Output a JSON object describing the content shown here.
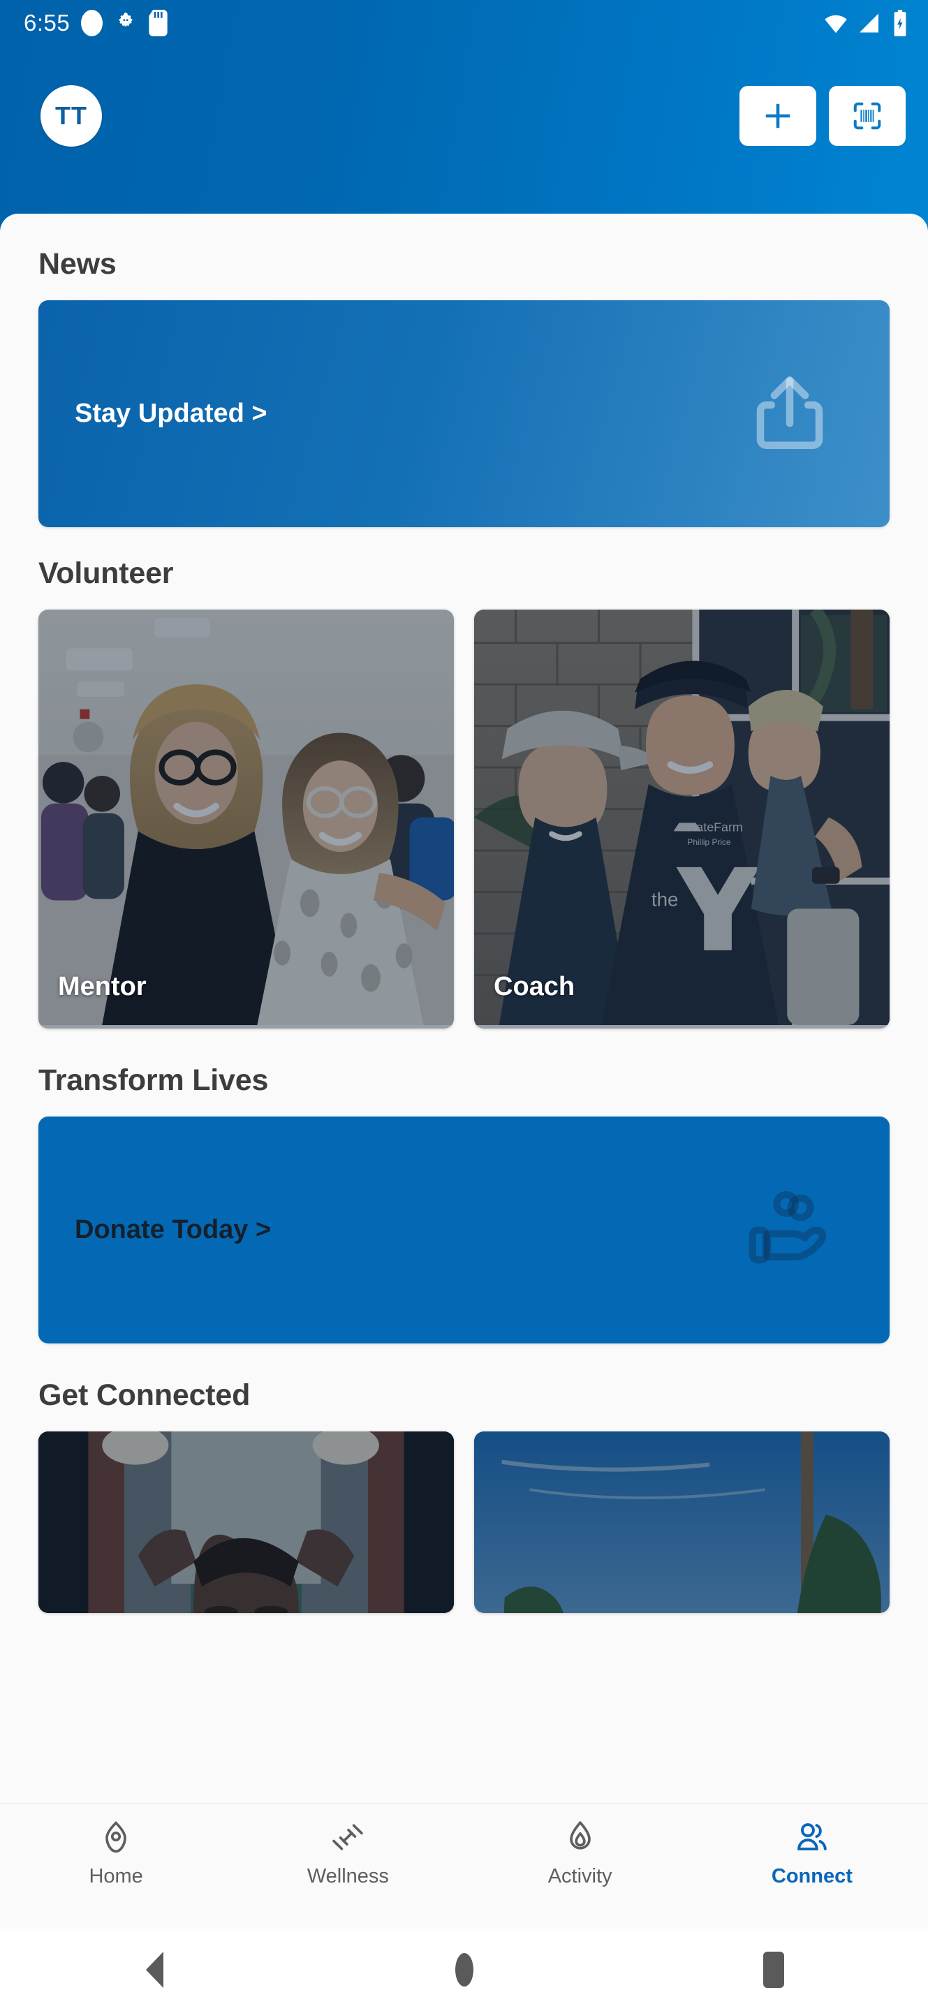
{
  "statusbar": {
    "time": "6:55",
    "left_icons": [
      "notification-dot-icon",
      "android-bug-icon",
      "sd-card-icon"
    ],
    "right_icons": [
      "wifi-icon",
      "cellular-signal-icon",
      "battery-charging-icon"
    ]
  },
  "appbar": {
    "avatar_initials": "TT",
    "add_label": "+",
    "actions": [
      "add-button",
      "scan-barcode-button"
    ]
  },
  "sections": [
    {
      "title": "News",
      "banner": {
        "label": "Stay Updated >",
        "icon": "share-icon",
        "accent": "#0a63ab"
      }
    },
    {
      "title": "Volunteer",
      "tiles": [
        {
          "label": "Mentor"
        },
        {
          "label": "Coach"
        }
      ]
    },
    {
      "title": "Transform Lives",
      "banner": {
        "label": "Donate Today >",
        "icon": "donate-hand-icon",
        "accent": "#0469b4"
      }
    },
    {
      "title": "Get Connected",
      "tiles": [
        {
          "label": ""
        },
        {
          "label": ""
        }
      ]
    }
  ],
  "bottom_nav": {
    "active": "Connect",
    "items": [
      {
        "label": "Home",
        "icon": "location-pin-icon"
      },
      {
        "label": "Wellness",
        "icon": "dumbbell-icon"
      },
      {
        "label": "Activity",
        "icon": "flame-icon"
      },
      {
        "label": "Connect",
        "icon": "people-icon"
      }
    ]
  },
  "system_nav": {
    "back": "back-button",
    "home": "home-button",
    "recents": "recents-button"
  },
  "colors": {
    "header_start": "#0062ab",
    "header_end": "#0085d2",
    "accent": "#0a66ba",
    "nav_inactive": "#5e5e5e",
    "heading": "#3d3d3d"
  }
}
